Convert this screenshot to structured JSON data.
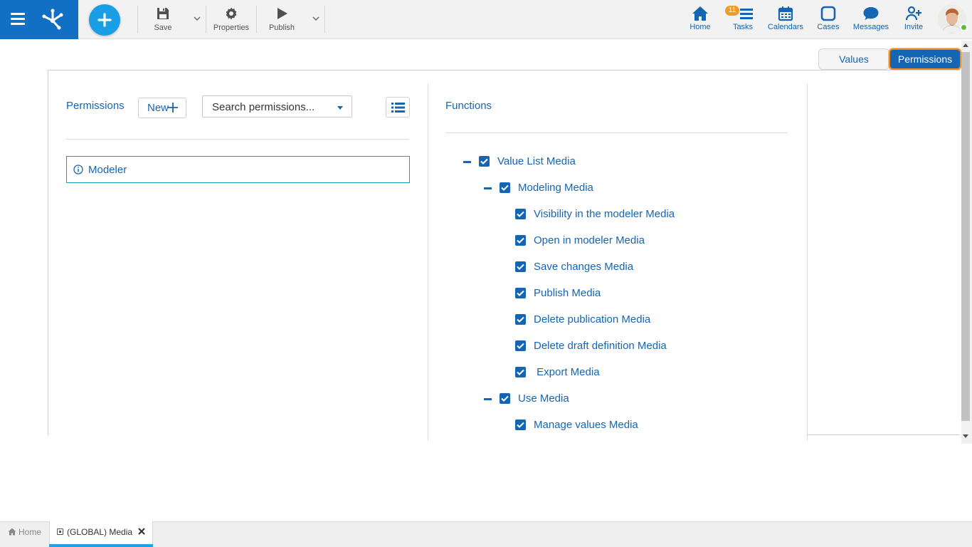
{
  "toolbar": {
    "save_label": "Save",
    "properties_label": "Properties",
    "publish_label": "Publish"
  },
  "nav": {
    "home_label": "Home",
    "tasks_label": "Tasks",
    "tasks_badge": "11",
    "calendars_label": "Calendars",
    "cases_label": "Cases",
    "messages_label": "Messages",
    "invite_label": "Invite"
  },
  "view_tabs": {
    "values_label": "Values",
    "permissions_label": "Permissions",
    "active": "Permissions"
  },
  "permissions": {
    "title": "Permissions",
    "new_label": "New",
    "search_placeholder": "Search permissions...",
    "items": [
      {
        "label": "Modeler"
      }
    ]
  },
  "functions": {
    "title": "Functions",
    "tree": [
      {
        "label": "Value List Media",
        "level": 0,
        "checked": true,
        "expanded": true
      },
      {
        "label": "Modeling Media",
        "level": 1,
        "checked": true,
        "expanded": true
      },
      {
        "label": "Visibility in the modeler Media",
        "level": 2,
        "checked": true
      },
      {
        "label": "Open in modeler Media",
        "level": 2,
        "checked": true
      },
      {
        "label": "Save changes Media",
        "level": 2,
        "checked": true
      },
      {
        "label": "Publish Media",
        "level": 2,
        "checked": true
      },
      {
        "label": "Delete publication Media",
        "level": 2,
        "checked": true
      },
      {
        "label": "Delete draft definition Media",
        "level": 2,
        "checked": true
      },
      {
        "label": " Export Media",
        "level": 2,
        "checked": true
      },
      {
        "label": "Use Media",
        "level": 1,
        "checked": true,
        "expanded": true
      },
      {
        "label": "Manage values Media",
        "level": 2,
        "checked": true
      }
    ]
  },
  "bottom_tabs": {
    "home_label": "Home",
    "media_label": "(GLOBAL) Media"
  },
  "colors": {
    "brand": "#1170c4",
    "accent": "#1565b3",
    "active_outline": "#ee8a1e",
    "badge": "#f39c1f",
    "tab_accent": "#1ea1e8"
  }
}
